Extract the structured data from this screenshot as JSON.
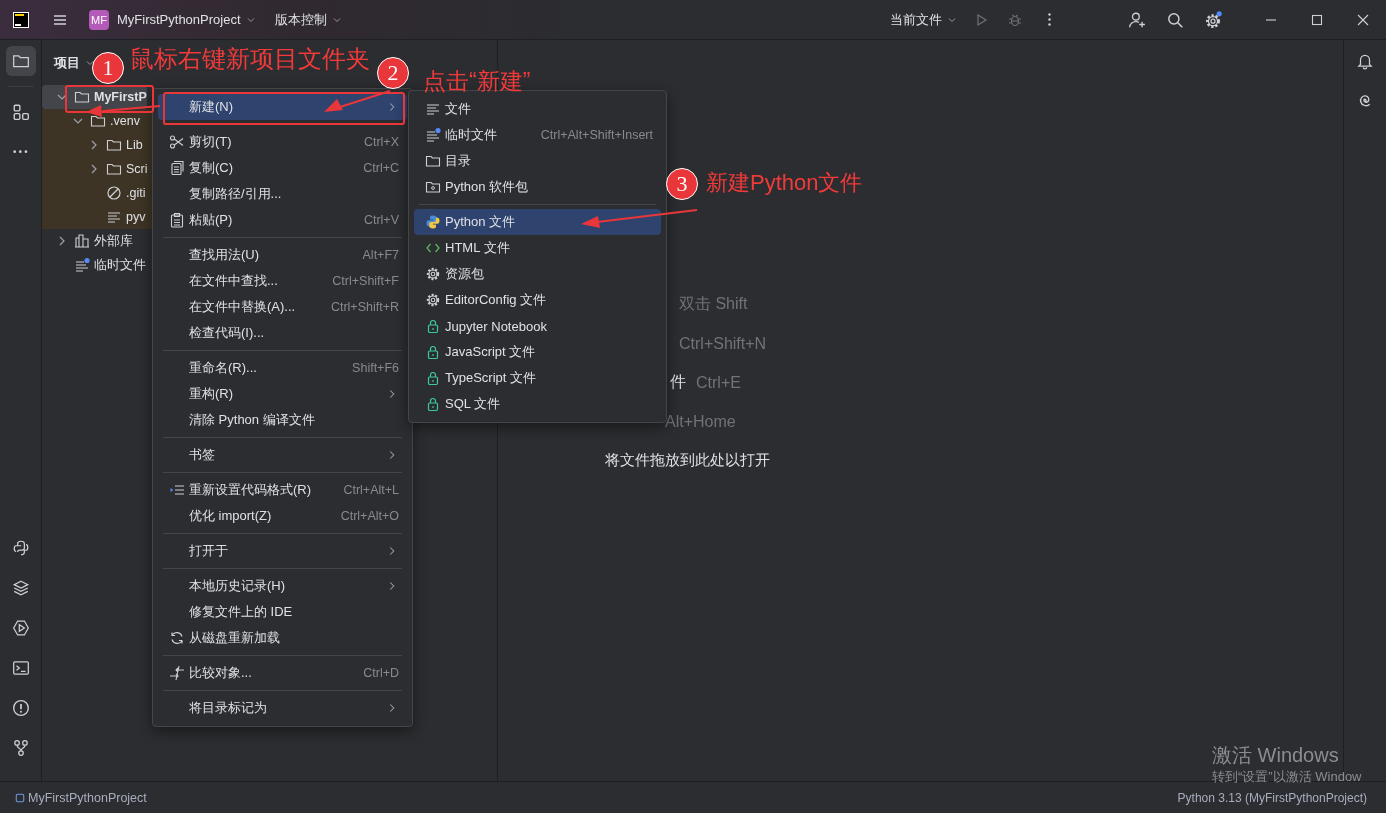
{
  "title_bar": {
    "project_badge": "MF",
    "project_name": "MyFirstPythonProject",
    "vcs_menu": "版本控制",
    "run_config": "当前文件"
  },
  "project_panel": {
    "title": "项目",
    "tree": [
      {
        "label": "MyFirstP",
        "kind": "folder",
        "expanded": true,
        "selected": true,
        "children": [
          {
            "label": ".venv",
            "kind": "folder",
            "expanded": true,
            "selected": false,
            "excluded": true,
            "children": [
              {
                "label": "Lib",
                "kind": "folder",
                "expanded": false,
                "selected": false
              },
              {
                "label": "Scri",
                "kind": "folder",
                "expanded": false,
                "selected": false
              },
              {
                "label": ".giti",
                "kind": "ignore-file",
                "selected": false
              },
              {
                "label": "pyv",
                "kind": "text-file",
                "selected": false
              }
            ]
          }
        ]
      },
      {
        "label": "外部库",
        "kind": "library",
        "expanded": false,
        "selected": false
      },
      {
        "label": "临时文件",
        "kind": "scratches",
        "selected": false
      }
    ]
  },
  "context_menu": {
    "items": [
      {
        "kind": "item",
        "label": "新建(N)",
        "submenu": true,
        "selected": true
      },
      {
        "kind": "separator"
      },
      {
        "kind": "item",
        "label": "剪切(T)",
        "shortcut": "Ctrl+X",
        "selected": false
      },
      {
        "kind": "item",
        "label": "复制(C)",
        "shortcut": "Ctrl+C",
        "selected": false
      },
      {
        "kind": "item",
        "label": "复制路径/引用...",
        "selected": false
      },
      {
        "kind": "item",
        "label": "粘贴(P)",
        "shortcut": "Ctrl+V",
        "selected": false
      },
      {
        "kind": "separator"
      },
      {
        "kind": "item",
        "label": "查找用法(U)",
        "shortcut": "Alt+F7",
        "selected": false
      },
      {
        "kind": "item",
        "label": "在文件中查找...",
        "shortcut": "Ctrl+Shift+F",
        "selected": false
      },
      {
        "kind": "item",
        "label": "在文件中替换(A)...",
        "shortcut": "Ctrl+Shift+R",
        "selected": false
      },
      {
        "kind": "item",
        "label": "检查代码(I)...",
        "selected": false
      },
      {
        "kind": "separator"
      },
      {
        "kind": "item",
        "label": "重命名(R)...",
        "shortcut": "Shift+F6",
        "selected": false
      },
      {
        "kind": "item",
        "label": "重构(R)",
        "submenu": true,
        "selected": false
      },
      {
        "kind": "item",
        "label": "清除 Python 编译文件",
        "selected": false
      },
      {
        "kind": "separator"
      },
      {
        "kind": "item",
        "label": "书签",
        "submenu": true,
        "selected": false
      },
      {
        "kind": "separator"
      },
      {
        "kind": "item",
        "label": "重新设置代码格式(R)",
        "shortcut": "Ctrl+Alt+L",
        "selected": false
      },
      {
        "kind": "item",
        "label": "优化 import(Z)",
        "shortcut": "Ctrl+Alt+O",
        "selected": false
      },
      {
        "kind": "separator"
      },
      {
        "kind": "item",
        "label": "打开于",
        "submenu": true,
        "selected": false
      },
      {
        "kind": "separator"
      },
      {
        "kind": "item",
        "label": "本地历史记录(H)",
        "submenu": true,
        "selected": false
      },
      {
        "kind": "item",
        "label": "修复文件上的 IDE",
        "selected": false
      },
      {
        "kind": "item",
        "label": "从磁盘重新加载",
        "selected": false
      },
      {
        "kind": "separator"
      },
      {
        "kind": "item",
        "label": "比较对象...",
        "shortcut": "Ctrl+D",
        "selected": false
      },
      {
        "kind": "separator"
      },
      {
        "kind": "item",
        "label": "将目录标记为",
        "submenu": true,
        "selected": false
      }
    ]
  },
  "submenu": {
    "items": [
      {
        "kind": "item",
        "label": "文件",
        "selected": false
      },
      {
        "kind": "item",
        "label": "临时文件",
        "shortcut": "Ctrl+Alt+Shift+Insert",
        "selected": false
      },
      {
        "kind": "item",
        "label": "目录",
        "selected": false
      },
      {
        "kind": "item",
        "label": "Python 软件包",
        "selected": false
      },
      {
        "kind": "separator"
      },
      {
        "kind": "item",
        "label": "Python 文件",
        "selected": true
      },
      {
        "kind": "item",
        "label": "HTML 文件",
        "selected": false
      },
      {
        "kind": "item",
        "label": "资源包",
        "selected": false
      },
      {
        "kind": "item",
        "label": "EditorConfig 文件",
        "selected": false
      },
      {
        "kind": "item",
        "label": "Jupyter Notebook",
        "selected": false
      },
      {
        "kind": "item",
        "label": "JavaScript 文件",
        "selected": false
      },
      {
        "kind": "item",
        "label": "TypeScript 文件",
        "selected": false
      },
      {
        "kind": "item",
        "label": "SQL 文件",
        "selected": false
      }
    ]
  },
  "editor": {
    "hints": [
      {
        "shortcut": "双击 Shift"
      },
      {
        "shortcut": "Ctrl+Shift+N"
      },
      {
        "label": "件",
        "shortcut": "Ctrl+E"
      },
      {
        "shortcut": "Alt+Home"
      }
    ],
    "drop_text": "将文件拖放到此处以打开"
  },
  "status_bar": {
    "project": "MyFirstPythonProject",
    "interpreter": "Python 3.13 (MyFirstPythonProject)"
  },
  "activation_notice": {
    "title": "激活 Windows",
    "text": "转到“设置”以激活 Window"
  },
  "annotations": [
    {
      "number": "1",
      "text": "鼠标右键新项目文件夹"
    },
    {
      "number": "2",
      "text": "点击“新建”"
    },
    {
      "number": "3",
      "text": "新建Python文件"
    }
  ]
}
